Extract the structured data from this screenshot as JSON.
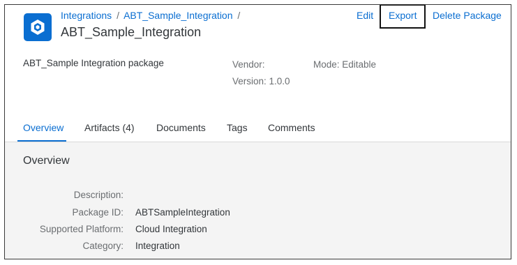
{
  "header": {
    "breadcrumb": [
      {
        "label": "Integrations"
      },
      {
        "label": "ABT_Sample_Integration"
      }
    ],
    "breadcrumb_separator": "/",
    "title": "ABT_Sample_Integration",
    "icon": "package-icon",
    "actions": {
      "edit": "Edit",
      "export": "Export",
      "delete": "Delete Package"
    }
  },
  "info": {
    "description": "ABT_Sample Integration package",
    "vendor": "Vendor:",
    "version": "Version: 1.0.0",
    "mode": "Mode: Editable"
  },
  "tabs": [
    {
      "label": "Overview",
      "active": true
    },
    {
      "label": "Artifacts (4)",
      "active": false
    },
    {
      "label": "Documents",
      "active": false
    },
    {
      "label": "Tags",
      "active": false
    },
    {
      "label": "Comments",
      "active": false
    }
  ],
  "overview": {
    "title": "Overview",
    "fields": [
      {
        "label": "Description:",
        "value": ""
      },
      {
        "label": "Package ID:",
        "value": "ABTSampleIntegration"
      },
      {
        "label": "Supported Platform:",
        "value": "Cloud Integration"
      },
      {
        "label": "Category:",
        "value": "Integration"
      }
    ]
  },
  "colors": {
    "accent": "#0a6ed1",
    "text": "#32363a",
    "muted": "#6a6d70",
    "content_bg": "#f4f4f4",
    "highlight_border": "#111111"
  }
}
